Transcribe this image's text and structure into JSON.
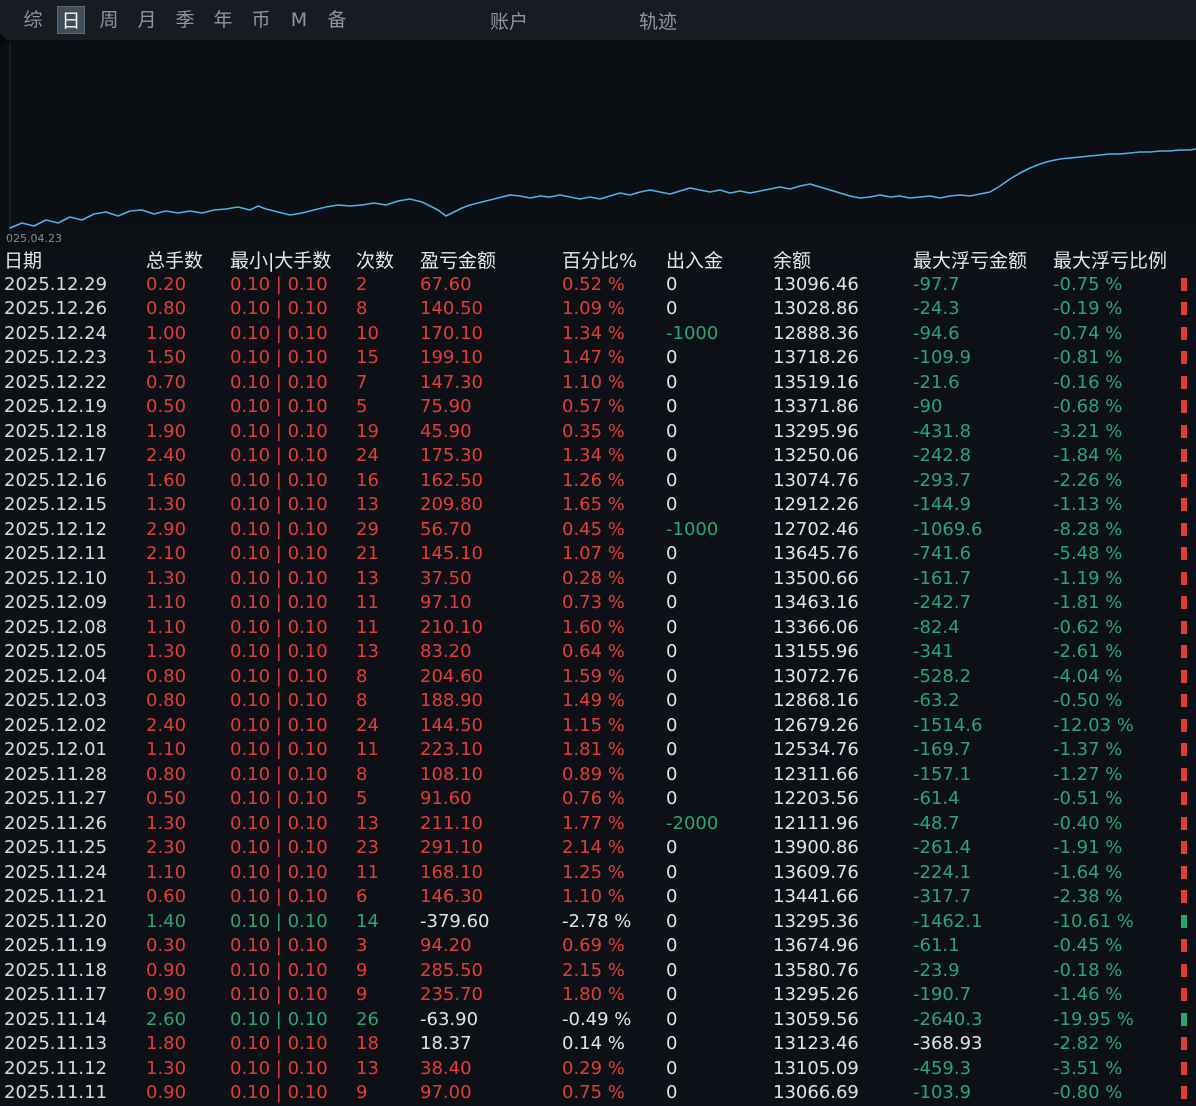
{
  "topbar": {
    "tabs": [
      {
        "label": "综",
        "selected": false
      },
      {
        "label": "日",
        "selected": true
      },
      {
        "label": "周",
        "selected": false
      },
      {
        "label": "月",
        "selected": false
      },
      {
        "label": "季",
        "selected": false
      },
      {
        "label": "年",
        "selected": false
      },
      {
        "label": "币",
        "selected": false
      },
      {
        "label": "M",
        "selected": false
      },
      {
        "label": "备",
        "selected": false
      }
    ],
    "menus": [
      "账户",
      "轨迹"
    ]
  },
  "chart_data": {
    "type": "line",
    "title": "",
    "timestamp_label": "025.04.23",
    "line_color": "#4fb1e8",
    "legend": [],
    "grid": false,
    "points": [
      [
        10,
        188
      ],
      [
        22,
        183
      ],
      [
        34,
        186
      ],
      [
        46,
        180
      ],
      [
        58,
        183
      ],
      [
        70,
        177
      ],
      [
        82,
        180
      ],
      [
        94,
        174
      ],
      [
        106,
        172
      ],
      [
        118,
        176
      ],
      [
        130,
        171
      ],
      [
        142,
        170
      ],
      [
        154,
        174
      ],
      [
        166,
        171
      ],
      [
        178,
        173
      ],
      [
        190,
        171
      ],
      [
        202,
        173
      ],
      [
        214,
        170
      ],
      [
        226,
        169
      ],
      [
        238,
        167
      ],
      [
        250,
        170
      ],
      [
        258,
        166
      ],
      [
        266,
        169
      ],
      [
        278,
        172
      ],
      [
        290,
        175
      ],
      [
        302,
        173
      ],
      [
        314,
        170
      ],
      [
        326,
        167
      ],
      [
        338,
        165
      ],
      [
        350,
        166
      ],
      [
        362,
        165
      ],
      [
        374,
        163
      ],
      [
        386,
        165
      ],
      [
        398,
        161
      ],
      [
        410,
        159
      ],
      [
        422,
        162
      ],
      [
        430,
        166
      ],
      [
        438,
        170
      ],
      [
        446,
        176
      ],
      [
        454,
        172
      ],
      [
        462,
        168
      ],
      [
        470,
        165
      ],
      [
        478,
        163
      ],
      [
        486,
        161
      ],
      [
        494,
        159
      ],
      [
        502,
        157
      ],
      [
        510,
        155
      ],
      [
        520,
        156
      ],
      [
        530,
        158
      ],
      [
        540,
        156
      ],
      [
        550,
        157
      ],
      [
        560,
        155
      ],
      [
        570,
        157
      ],
      [
        580,
        159
      ],
      [
        590,
        157
      ],
      [
        600,
        159
      ],
      [
        610,
        156
      ],
      [
        620,
        153
      ],
      [
        630,
        155
      ],
      [
        640,
        152
      ],
      [
        650,
        150
      ],
      [
        660,
        152
      ],
      [
        670,
        154
      ],
      [
        680,
        151
      ],
      [
        690,
        148
      ],
      [
        700,
        150
      ],
      [
        710,
        152
      ],
      [
        720,
        150
      ],
      [
        730,
        153
      ],
      [
        740,
        151
      ],
      [
        750,
        153
      ],
      [
        760,
        151
      ],
      [
        770,
        149
      ],
      [
        780,
        147
      ],
      [
        790,
        149
      ],
      [
        800,
        146
      ],
      [
        810,
        144
      ],
      [
        820,
        147
      ],
      [
        830,
        150
      ],
      [
        840,
        153
      ],
      [
        850,
        156
      ],
      [
        860,
        158
      ],
      [
        870,
        157
      ],
      [
        880,
        155
      ],
      [
        890,
        157
      ],
      [
        900,
        156
      ],
      [
        910,
        158
      ],
      [
        920,
        157
      ],
      [
        930,
        156
      ],
      [
        940,
        158
      ],
      [
        950,
        156
      ],
      [
        960,
        155
      ],
      [
        970,
        156
      ],
      [
        980,
        154
      ],
      [
        990,
        152
      ],
      [
        1000,
        146
      ],
      [
        1010,
        139
      ],
      [
        1020,
        133
      ],
      [
        1030,
        128
      ],
      [
        1040,
        124
      ],
      [
        1050,
        121
      ],
      [
        1060,
        119
      ],
      [
        1070,
        118
      ],
      [
        1080,
        117
      ],
      [
        1090,
        116
      ],
      [
        1100,
        115
      ],
      [
        1110,
        114
      ],
      [
        1120,
        114
      ],
      [
        1130,
        113
      ],
      [
        1140,
        112
      ],
      [
        1150,
        112
      ],
      [
        1160,
        111
      ],
      [
        1170,
        111
      ],
      [
        1180,
        110
      ],
      [
        1190,
        110
      ],
      [
        1196,
        109
      ]
    ]
  },
  "colors": {
    "red": "#e23d35",
    "green": "#2ca56d",
    "teal": "#28a37a",
    "white": "#dfe3e7",
    "date": "#d7dbdf",
    "header": "#e4e8ec"
  },
  "table": {
    "headers": [
      "日期",
      "总手数",
      "最小|大手数",
      "次数",
      "盈亏金额",
      "百分比%",
      "出入金",
      "余额",
      "最大浮亏金额",
      "最大浮亏比例"
    ],
    "rows": [
      {
        "date": "2025.12.29",
        "lots": "0.20",
        "mm": "0.10 | 0.10",
        "n": "2",
        "pnl": "67.60",
        "pct": "0.52 %",
        "cash": "0",
        "bal": "13096.46",
        "fa": "-97.7",
        "fp": "-0.75 %"
      },
      {
        "date": "2025.12.26",
        "lots": "0.80",
        "mm": "0.10 | 0.10",
        "n": "8",
        "pnl": "140.50",
        "pct": "1.09 %",
        "cash": "0",
        "bal": "13028.86",
        "fa": "-24.3",
        "fp": "-0.19 %"
      },
      {
        "date": "2025.12.24",
        "lots": "1.00",
        "mm": "0.10 | 0.10",
        "n": "10",
        "pnl": "170.10",
        "pct": "1.34 %",
        "cash": "-1000",
        "bal": "12888.36",
        "fa": "-94.6",
        "fp": "-0.74 %"
      },
      {
        "date": "2025.12.23",
        "lots": "1.50",
        "mm": "0.10 | 0.10",
        "n": "15",
        "pnl": "199.10",
        "pct": "1.47 %",
        "cash": "0",
        "bal": "13718.26",
        "fa": "-109.9",
        "fp": "-0.81 %"
      },
      {
        "date": "2025.12.22",
        "lots": "0.70",
        "mm": "0.10 | 0.10",
        "n": "7",
        "pnl": "147.30",
        "pct": "1.10 %",
        "cash": "0",
        "bal": "13519.16",
        "fa": "-21.6",
        "fp": "-0.16 %"
      },
      {
        "date": "2025.12.19",
        "lots": "0.50",
        "mm": "0.10 | 0.10",
        "n": "5",
        "pnl": "75.90",
        "pct": "0.57 %",
        "cash": "0",
        "bal": "13371.86",
        "fa": "-90",
        "fp": "-0.68 %"
      },
      {
        "date": "2025.12.18",
        "lots": "1.90",
        "mm": "0.10 | 0.10",
        "n": "19",
        "pnl": "45.90",
        "pct": "0.35 %",
        "cash": "0",
        "bal": "13295.96",
        "fa": "-431.8",
        "fp": "-3.21 %"
      },
      {
        "date": "2025.12.17",
        "lots": "2.40",
        "mm": "0.10 | 0.10",
        "n": "24",
        "pnl": "175.30",
        "pct": "1.34 %",
        "cash": "0",
        "bal": "13250.06",
        "fa": "-242.8",
        "fp": "-1.84 %"
      },
      {
        "date": "2025.12.16",
        "lots": "1.60",
        "mm": "0.10 | 0.10",
        "n": "16",
        "pnl": "162.50",
        "pct": "1.26 %",
        "cash": "0",
        "bal": "13074.76",
        "fa": "-293.7",
        "fp": "-2.26 %"
      },
      {
        "date": "2025.12.15",
        "lots": "1.30",
        "mm": "0.10 | 0.10",
        "n": "13",
        "pnl": "209.80",
        "pct": "1.65 %",
        "cash": "0",
        "bal": "12912.26",
        "fa": "-144.9",
        "fp": "-1.13 %"
      },
      {
        "date": "2025.12.12",
        "lots": "2.90",
        "mm": "0.10 | 0.10",
        "n": "29",
        "pnl": "56.70",
        "pct": "0.45 %",
        "cash": "-1000",
        "bal": "12702.46",
        "fa": "-1069.6",
        "fp": "-8.28 %"
      },
      {
        "date": "2025.12.11",
        "lots": "2.10",
        "mm": "0.10 | 0.10",
        "n": "21",
        "pnl": "145.10",
        "pct": "1.07 %",
        "cash": "0",
        "bal": "13645.76",
        "fa": "-741.6",
        "fp": "-5.48 %"
      },
      {
        "date": "2025.12.10",
        "lots": "1.30",
        "mm": "0.10 | 0.10",
        "n": "13",
        "pnl": "37.50",
        "pct": "0.28 %",
        "cash": "0",
        "bal": "13500.66",
        "fa": "-161.7",
        "fp": "-1.19 %"
      },
      {
        "date": "2025.12.09",
        "lots": "1.10",
        "mm": "0.10 | 0.10",
        "n": "11",
        "pnl": "97.10",
        "pct": "0.73 %",
        "cash": "0",
        "bal": "13463.16",
        "fa": "-242.7",
        "fp": "-1.81 %"
      },
      {
        "date": "2025.12.08",
        "lots": "1.10",
        "mm": "0.10 | 0.10",
        "n": "11",
        "pnl": "210.10",
        "pct": "1.60 %",
        "cash": "0",
        "bal": "13366.06",
        "fa": "-82.4",
        "fp": "-0.62 %"
      },
      {
        "date": "2025.12.05",
        "lots": "1.30",
        "mm": "0.10 | 0.10",
        "n": "13",
        "pnl": "83.20",
        "pct": "0.64 %",
        "cash": "0",
        "bal": "13155.96",
        "fa": "-341",
        "fp": "-2.61 %"
      },
      {
        "date": "2025.12.04",
        "lots": "0.80",
        "mm": "0.10 | 0.10",
        "n": "8",
        "pnl": "204.60",
        "pct": "1.59 %",
        "cash": "0",
        "bal": "13072.76",
        "fa": "-528.2",
        "fp": "-4.04 %"
      },
      {
        "date": "2025.12.03",
        "lots": "0.80",
        "mm": "0.10 | 0.10",
        "n": "8",
        "pnl": "188.90",
        "pct": "1.49 %",
        "cash": "0",
        "bal": "12868.16",
        "fa": "-63.2",
        "fp": "-0.50 %"
      },
      {
        "date": "2025.12.02",
        "lots": "2.40",
        "mm": "0.10 | 0.10",
        "n": "24",
        "pnl": "144.50",
        "pct": "1.15 %",
        "cash": "0",
        "bal": "12679.26",
        "fa": "-1514.6",
        "fp": "-12.03 %"
      },
      {
        "date": "2025.12.01",
        "lots": "1.10",
        "mm": "0.10 | 0.10",
        "n": "11",
        "pnl": "223.10",
        "pct": "1.81 %",
        "cash": "0",
        "bal": "12534.76",
        "fa": "-169.7",
        "fp": "-1.37 %"
      },
      {
        "date": "2025.11.28",
        "lots": "0.80",
        "mm": "0.10 | 0.10",
        "n": "8",
        "pnl": "108.10",
        "pct": "0.89 %",
        "cash": "0",
        "bal": "12311.66",
        "fa": "-157.1",
        "fp": "-1.27 %"
      },
      {
        "date": "2025.11.27",
        "lots": "0.50",
        "mm": "0.10 | 0.10",
        "n": "5",
        "pnl": "91.60",
        "pct": "0.76 %",
        "cash": "0",
        "bal": "12203.56",
        "fa": "-61.4",
        "fp": "-0.51 %"
      },
      {
        "date": "2025.11.26",
        "lots": "1.30",
        "mm": "0.10 | 0.10",
        "n": "13",
        "pnl": "211.10",
        "pct": "1.77 %",
        "cash": "-2000",
        "bal": "12111.96",
        "fa": "-48.7",
        "fp": "-0.40 %"
      },
      {
        "date": "2025.11.25",
        "lots": "2.30",
        "mm": "0.10 | 0.10",
        "n": "23",
        "pnl": "291.10",
        "pct": "2.14 %",
        "cash": "0",
        "bal": "13900.86",
        "fa": "-261.4",
        "fp": "-1.91 %"
      },
      {
        "date": "2025.11.24",
        "lots": "1.10",
        "mm": "0.10 | 0.10",
        "n": "11",
        "pnl": "168.10",
        "pct": "1.25 %",
        "cash": "0",
        "bal": "13609.76",
        "fa": "-224.1",
        "fp": "-1.64 %"
      },
      {
        "date": "2025.11.21",
        "lots": "0.60",
        "mm": "0.10 | 0.10",
        "n": "6",
        "pnl": "146.30",
        "pct": "1.10 %",
        "cash": "0",
        "bal": "13441.66",
        "fa": "-317.7",
        "fp": "-2.38 %"
      },
      {
        "date": "2025.11.20",
        "lots": "1.40",
        "mm": "0.10 | 0.10",
        "n": "14",
        "pnl": "-379.60",
        "pct": "-2.78 %",
        "cash": "0",
        "bal": "13295.36",
        "fa": "-1462.1",
        "fp": "-10.61 %",
        "tone": "green",
        "pnlc": "white",
        "pctc": "white"
      },
      {
        "date": "2025.11.19",
        "lots": "0.30",
        "mm": "0.10 | 0.10",
        "n": "3",
        "pnl": "94.20",
        "pct": "0.69 %",
        "cash": "0",
        "bal": "13674.96",
        "fa": "-61.1",
        "fp": "-0.45 %"
      },
      {
        "date": "2025.11.18",
        "lots": "0.90",
        "mm": "0.10 | 0.10",
        "n": "9",
        "pnl": "285.50",
        "pct": "2.15 %",
        "cash": "0",
        "bal": "13580.76",
        "fa": "-23.9",
        "fp": "-0.18 %"
      },
      {
        "date": "2025.11.17",
        "lots": "0.90",
        "mm": "0.10 | 0.10",
        "n": "9",
        "pnl": "235.70",
        "pct": "1.80 %",
        "cash": "0",
        "bal": "13295.26",
        "fa": "-190.7",
        "fp": "-1.46 %"
      },
      {
        "date": "2025.11.14",
        "lots": "2.60",
        "mm": "0.10 | 0.10",
        "n": "26",
        "pnl": "-63.90",
        "pct": "-0.49 %",
        "cash": "0",
        "bal": "13059.56",
        "fa": "-2640.3",
        "fp": "-19.95 %",
        "tone": "green",
        "pnlc": "white",
        "pctc": "white"
      },
      {
        "date": "2025.11.13",
        "lots": "1.80",
        "mm": "0.10 | 0.10",
        "n": "18",
        "pnl": "18.37",
        "pct": "0.14 %",
        "cash": "0",
        "bal": "13123.46",
        "fa": "-368.93",
        "fp": "-2.82 %",
        "pnlc": "white",
        "pctc": "white",
        "fac": "white"
      },
      {
        "date": "2025.11.12",
        "lots": "1.30",
        "mm": "0.10 | 0.10",
        "n": "13",
        "pnl": "38.40",
        "pct": "0.29 %",
        "cash": "0",
        "bal": "13105.09",
        "fa": "-459.3",
        "fp": "-3.51 %"
      },
      {
        "date": "2025.11.11",
        "lots": "0.90",
        "mm": "0.10 | 0.10",
        "n": "9",
        "pnl": "97.00",
        "pct": "0.75 %",
        "cash": "0",
        "bal": "13066.69",
        "fa": "-103.9",
        "fp": "-0.80 %"
      }
    ]
  }
}
